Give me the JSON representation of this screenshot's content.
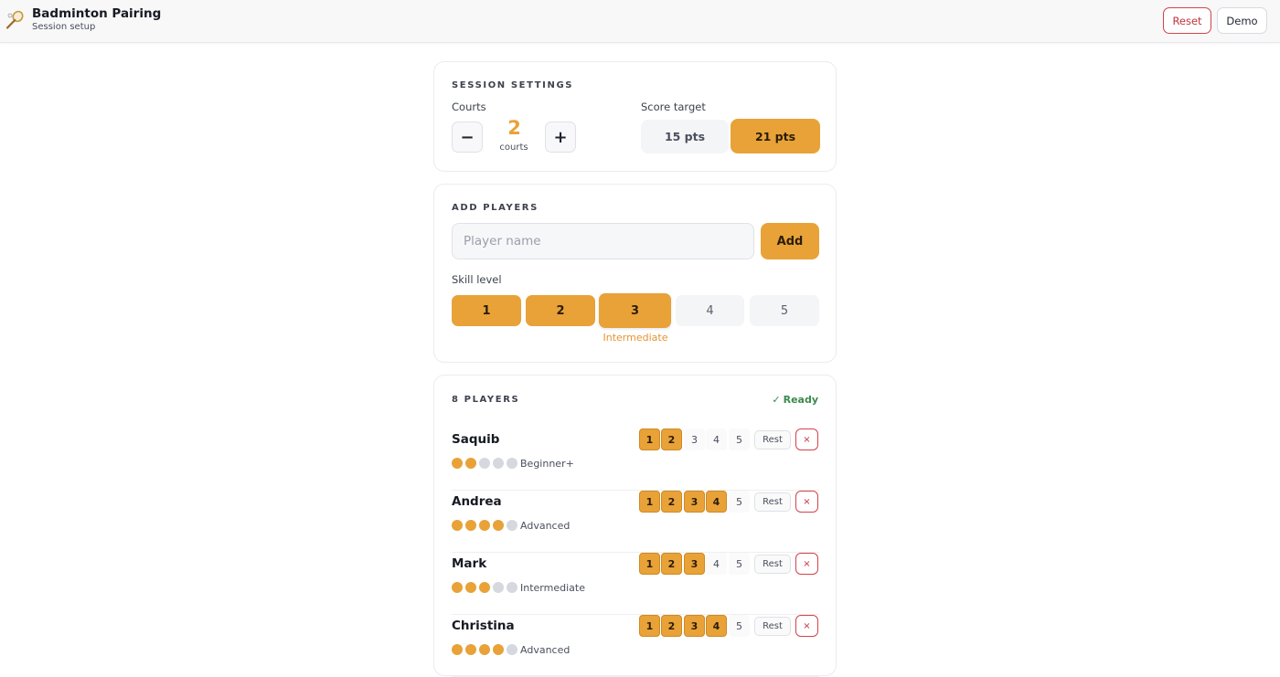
{
  "header": {
    "brand_icon": "badminton-racket-icon",
    "title": "Badminton Pairing",
    "subtitle": "Session setup",
    "reset_label": "Reset",
    "demo_label": "Demo"
  },
  "settings": {
    "section_label": "SESSION SETTINGS",
    "courts_label": "Courts",
    "decrement_label": "−",
    "increment_label": "+",
    "courts_value": "2",
    "courts_unit": "courts",
    "score_label": "Score target",
    "score_options": [
      "15 pts",
      "21 pts"
    ],
    "score_selected": "21 pts"
  },
  "add_players": {
    "section_label": "ADD PLAYERS",
    "input_value": "",
    "input_placeholder": "Player name",
    "add_label": "Add",
    "skill_label": "Skill level",
    "skill_levels": [
      "1",
      "2",
      "3",
      "4",
      "5"
    ],
    "skill_selected": "3",
    "skill_caption": "Intermediate"
  },
  "players": {
    "section_label": "8 PLAYERS",
    "ready_label": "Ready",
    "rest_label": "Rest",
    "remove_label": "×",
    "level_labels": [
      "1",
      "2",
      "3",
      "4",
      "5"
    ],
    "list": [
      {
        "name": "Saquib",
        "level": 2,
        "level_text": "Beginner+"
      },
      {
        "name": "Andrea",
        "level": 4,
        "level_text": "Advanced"
      },
      {
        "name": "Mark",
        "level": 3,
        "level_text": "Intermediate"
      },
      {
        "name": "Christina",
        "level": 4,
        "level_text": "Advanced"
      }
    ]
  },
  "colors": {
    "accent": "#e8a238",
    "danger": "#c5333b",
    "ready": "#3b8a4e"
  }
}
